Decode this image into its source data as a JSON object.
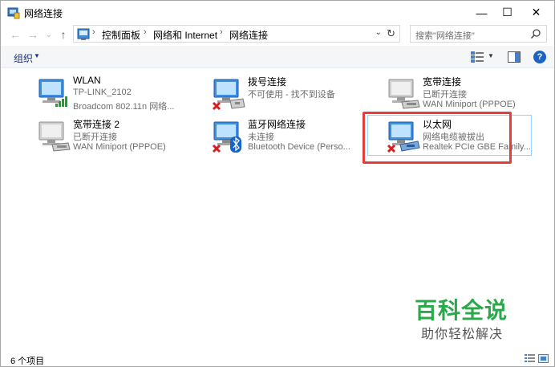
{
  "window": {
    "title": "网络连接",
    "controls": {
      "minimize": "—",
      "maximize": "☐",
      "close": "✕"
    }
  },
  "nav": {
    "back": "←",
    "forward": "→",
    "recent": "⌄",
    "up": "↑",
    "breadcrumb": [
      "控制面板",
      "网络和 Internet",
      "网络连接"
    ],
    "separator": "›",
    "dropdown": "⌄",
    "refresh": "↻",
    "search_placeholder": "搜索\"网络连接\""
  },
  "cmdbar": {
    "organize": "组织",
    "organize_arrow": "▼",
    "view_arrow": "▼",
    "help": "?"
  },
  "items": [
    {
      "name": "WLAN",
      "status": "TP-LINK_2102",
      "device": "Broadcom 802.11n 网络...",
      "icon": "wifi-adapter-icon",
      "disconnected": false
    },
    {
      "name": "拨号连接",
      "status": "不可使用 - 找不到设备",
      "device": "",
      "icon": "dialup-modem-icon",
      "disconnected": true
    },
    {
      "name": "宽带连接",
      "status": "已断开连接",
      "device": "WAN Miniport (PPPOE)",
      "icon": "wan-miniport-icon",
      "disconnected": false
    },
    {
      "name": "宽带连接 2",
      "status": "已断开连接",
      "device": "WAN Miniport (PPPOE)",
      "icon": "wan-miniport-icon",
      "disconnected": false
    },
    {
      "name": "蓝牙网络连接",
      "status": "未连接",
      "device": "Bluetooth Device (Perso...",
      "icon": "bluetooth-icon",
      "disconnected": true
    },
    {
      "name": "以太网",
      "status": "网络电缆被拔出",
      "device": "Realtek PCIe GBE Family...",
      "icon": "ethernet-adapter-icon",
      "disconnected": true
    }
  ],
  "status_bar": {
    "count": "6 个项目"
  },
  "watermark": {
    "title": "百科全说",
    "subtitle": "助你轻松解决"
  },
  "colors": {
    "accent": "#1e3287",
    "highlight_border": "#e63c3c",
    "watermark_green": "#2aa84a",
    "selection": "#99d1ff"
  }
}
